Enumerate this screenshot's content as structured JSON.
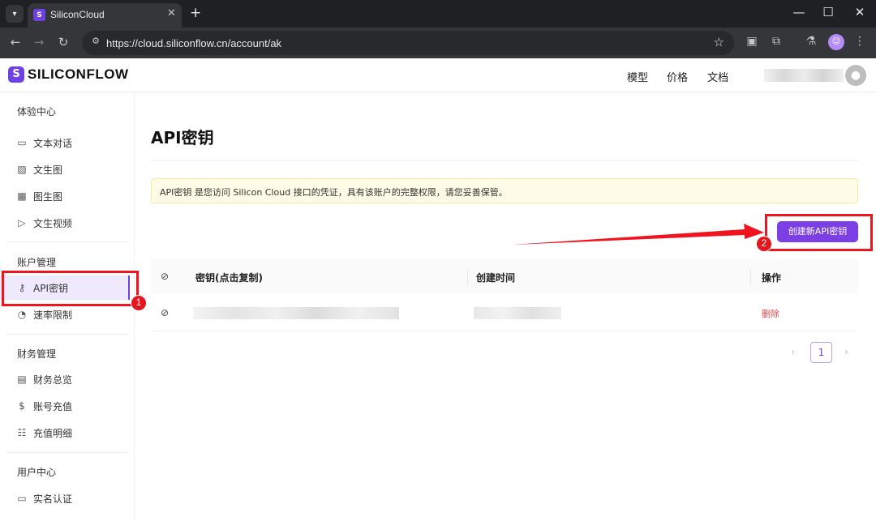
{
  "browser": {
    "tab_title": "SiliconCloud",
    "url": "https://cloud.siliconflow.cn/account/ak",
    "tab_close": "✕",
    "new_tab": "+",
    "minimize": "—",
    "maximize": "☐",
    "close": "✕"
  },
  "header": {
    "logo_text": "SILICONFLOW",
    "nav": [
      "模型",
      "价格",
      "文档"
    ]
  },
  "sidebar": {
    "groups": [
      {
        "title": "体验中心",
        "items": [
          {
            "label": "文本对话",
            "icon": "chat-icon"
          },
          {
            "label": "文生图",
            "icon": "image-icon"
          },
          {
            "label": "图生图",
            "icon": "image-edit-icon"
          },
          {
            "label": "文生视频",
            "icon": "video-icon"
          }
        ]
      },
      {
        "title": "账户管理",
        "items": [
          {
            "label": "API密钥",
            "icon": "key-icon",
            "active": true
          },
          {
            "label": "速率限制",
            "icon": "gauge-icon"
          }
        ]
      },
      {
        "title": "财务管理",
        "items": [
          {
            "label": "财务总览",
            "icon": "document-icon"
          },
          {
            "label": "账号充值",
            "icon": "dollar-icon"
          },
          {
            "label": "充值明细",
            "icon": "list-icon"
          }
        ]
      },
      {
        "title": "用户中心",
        "items": [
          {
            "label": "实名认证",
            "icon": "id-card-icon"
          }
        ]
      }
    ]
  },
  "main": {
    "title": "API密钥",
    "notice": "API密钥 是您访问 Silicon Cloud 接口的凭证，具有该账户的完整权限，请您妥善保管。",
    "create_button": "创建新API密钥",
    "table": {
      "columns": [
        "密钥(点击复制)",
        "创建时间",
        "操作"
      ],
      "rows": [
        {
          "action": "删除"
        }
      ]
    },
    "pagination": {
      "current": "1"
    }
  },
  "annotations": {
    "badge_1": "1",
    "badge_2": "2",
    "color": "#f0141e"
  },
  "colors": {
    "accent": "#6e41e2",
    "button": "#7b3fe4",
    "danger": "#e5484d"
  }
}
